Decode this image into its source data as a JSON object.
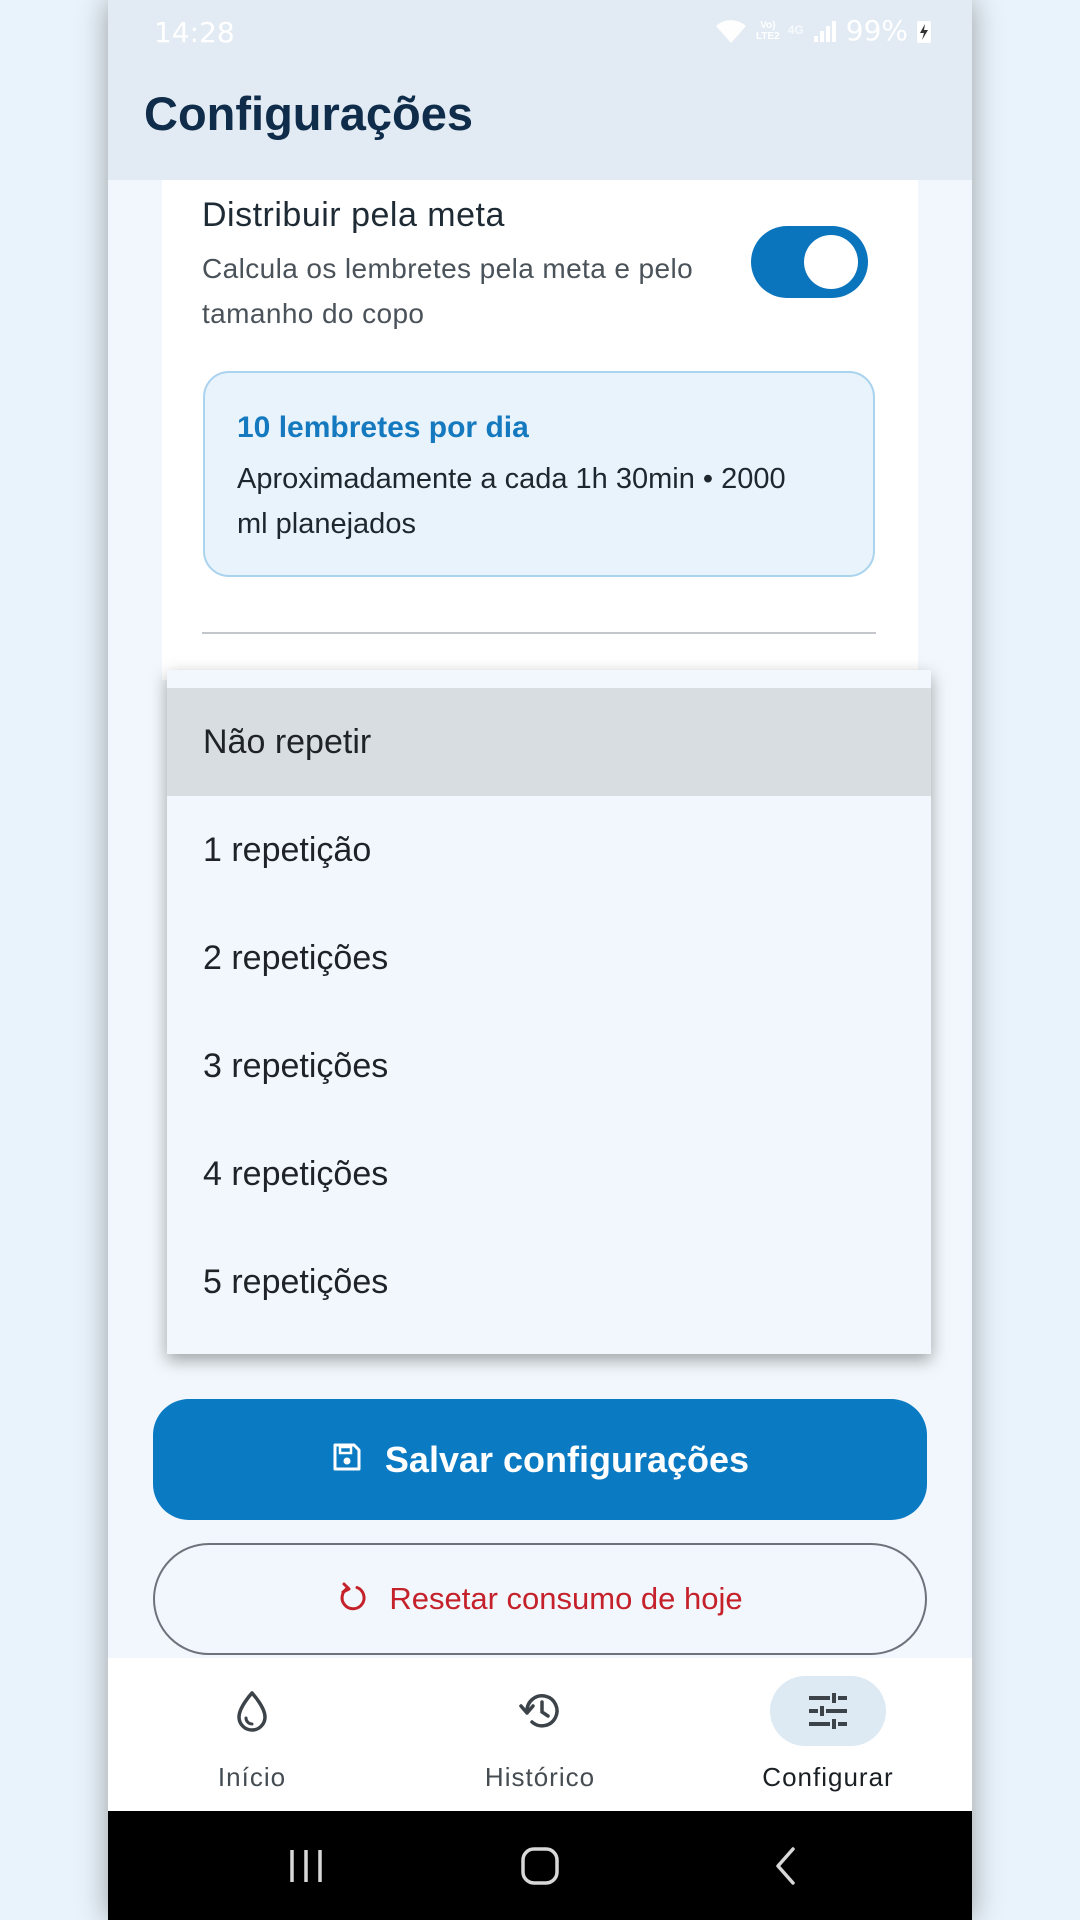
{
  "status_bar": {
    "time": "14:28",
    "battery_percent": "99%",
    "network_label_top": "Vo)",
    "network_label_bottom": "LTE2",
    "network_tag": "4G"
  },
  "app_bar": {
    "title": "Configurações"
  },
  "distribute": {
    "title": "Distribuir pela meta",
    "description": "Calcula os lembretes pela meta e pelo tamanho do copo",
    "toggle_on": true
  },
  "summary": {
    "title": "10 lembretes por dia",
    "text": "Aproximadamente a cada 1h 30min • 2000 ml planejados"
  },
  "dropdown": {
    "selected_index": 0,
    "options": [
      "Não repetir",
      "1 repetição",
      "2 repetições",
      "3 repetições",
      "4 repetições",
      "5 repetições"
    ]
  },
  "actions": {
    "save_label": "Salvar configurações",
    "reset_label": "Resetar consumo de hoje"
  },
  "bottom_nav": {
    "items": [
      {
        "label": "Início",
        "icon": "water-drop-icon"
      },
      {
        "label": "Histórico",
        "icon": "history-icon"
      },
      {
        "label": "Configurar",
        "icon": "tune-icon",
        "active": true
      }
    ]
  },
  "colors": {
    "primary": "#0a7ac3",
    "danger": "#c5212a",
    "title": "#0f2d4a"
  }
}
